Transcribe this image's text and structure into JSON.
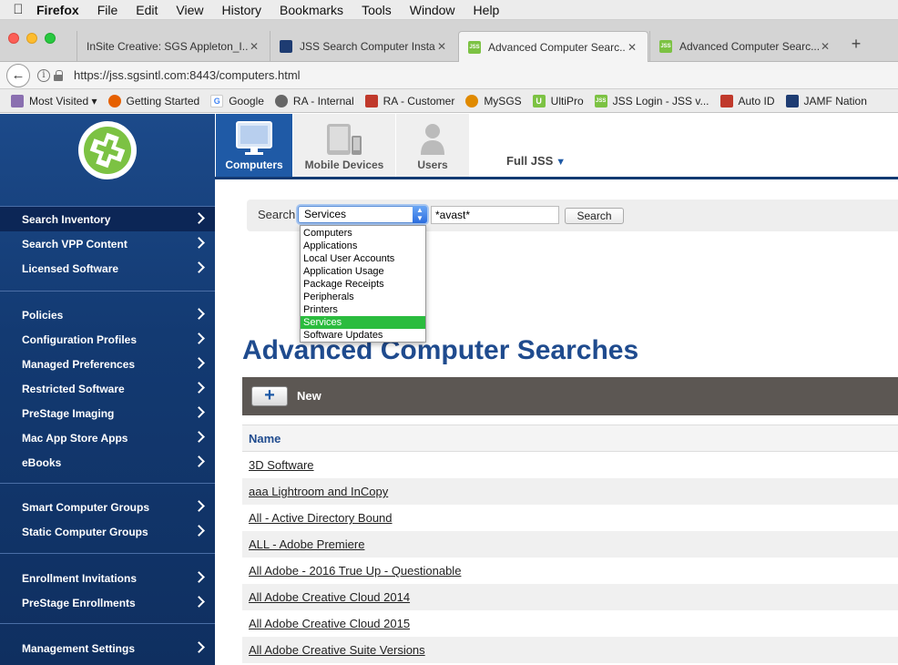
{
  "menubar": {
    "app": "Firefox",
    "items": [
      "File",
      "Edit",
      "View",
      "History",
      "Bookmarks",
      "Tools",
      "Window",
      "Help"
    ]
  },
  "tabs": [
    {
      "title": "InSite Creative: SGS Appleton_I...",
      "icon": "page-icon"
    },
    {
      "title": "JSS Search Computer Insta...",
      "icon": "jamf-icon"
    },
    {
      "title": "Advanced Computer Searc...",
      "icon": "jss-icon",
      "active": true
    },
    {
      "title": "Advanced Computer Searc...",
      "icon": "jss-icon"
    }
  ],
  "navbar": {
    "url": "https://jss.sgsintl.com:8443/computers.html"
  },
  "bookmarks": [
    {
      "label": "Most Visited ▾",
      "color": "#8a6fb0"
    },
    {
      "label": "Getting Started",
      "color": "#e66000"
    },
    {
      "label": "Google",
      "color": "#4285f4"
    },
    {
      "label": "RA - Internal",
      "color": "#666666"
    },
    {
      "label": "RA - Customer",
      "color": "#c0392b"
    },
    {
      "label": "MySGS",
      "color": "#e08a00"
    },
    {
      "label": "UltiPro",
      "color": "#7cc243"
    },
    {
      "label": "JSS Login - JSS v...",
      "color": "#7cc243"
    },
    {
      "label": "Auto ID",
      "color": "#c0392b"
    },
    {
      "label": "JAMF Nation",
      "color": "#1e3c72"
    }
  ],
  "appnav": {
    "computers": "Computers",
    "mobile": "Mobile Devices",
    "users": "Users",
    "fulljss": "Full JSS"
  },
  "sidebar": {
    "group1": [
      "Search Inventory",
      "Search VPP Content",
      "Licensed Software"
    ],
    "group2": [
      "Policies",
      "Configuration Profiles",
      "Managed Preferences",
      "Restricted Software",
      "PreStage Imaging",
      "Mac App Store Apps",
      "eBooks"
    ],
    "group3": [
      "Smart Computer Groups",
      "Static Computer Groups"
    ],
    "group4": [
      "Enrollment Invitations",
      "PreStage Enrollments"
    ],
    "group5": [
      "Management Settings"
    ]
  },
  "search": {
    "label": "Search",
    "selected": "Services",
    "value": "*avast*",
    "button": "Search",
    "options": [
      "Computers",
      "Applications",
      "Local User Accounts",
      "Application Usage",
      "Package Receipts",
      "Peripherals",
      "Printers",
      "Services",
      "Software Updates"
    ]
  },
  "main": {
    "title": "Advanced Computer Searches",
    "new_label": "New",
    "table_header": "Name",
    "rows": [
      "3D Software",
      "aaa Lightroom and InCopy",
      "All - Active Directory Bound",
      "ALL - Adobe Premiere",
      "All Adobe - 2016 True Up - Questionable",
      "All Adobe Creative Cloud 2014",
      "All Adobe Creative Cloud 2015",
      "All Adobe Creative Suite Versions"
    ]
  }
}
